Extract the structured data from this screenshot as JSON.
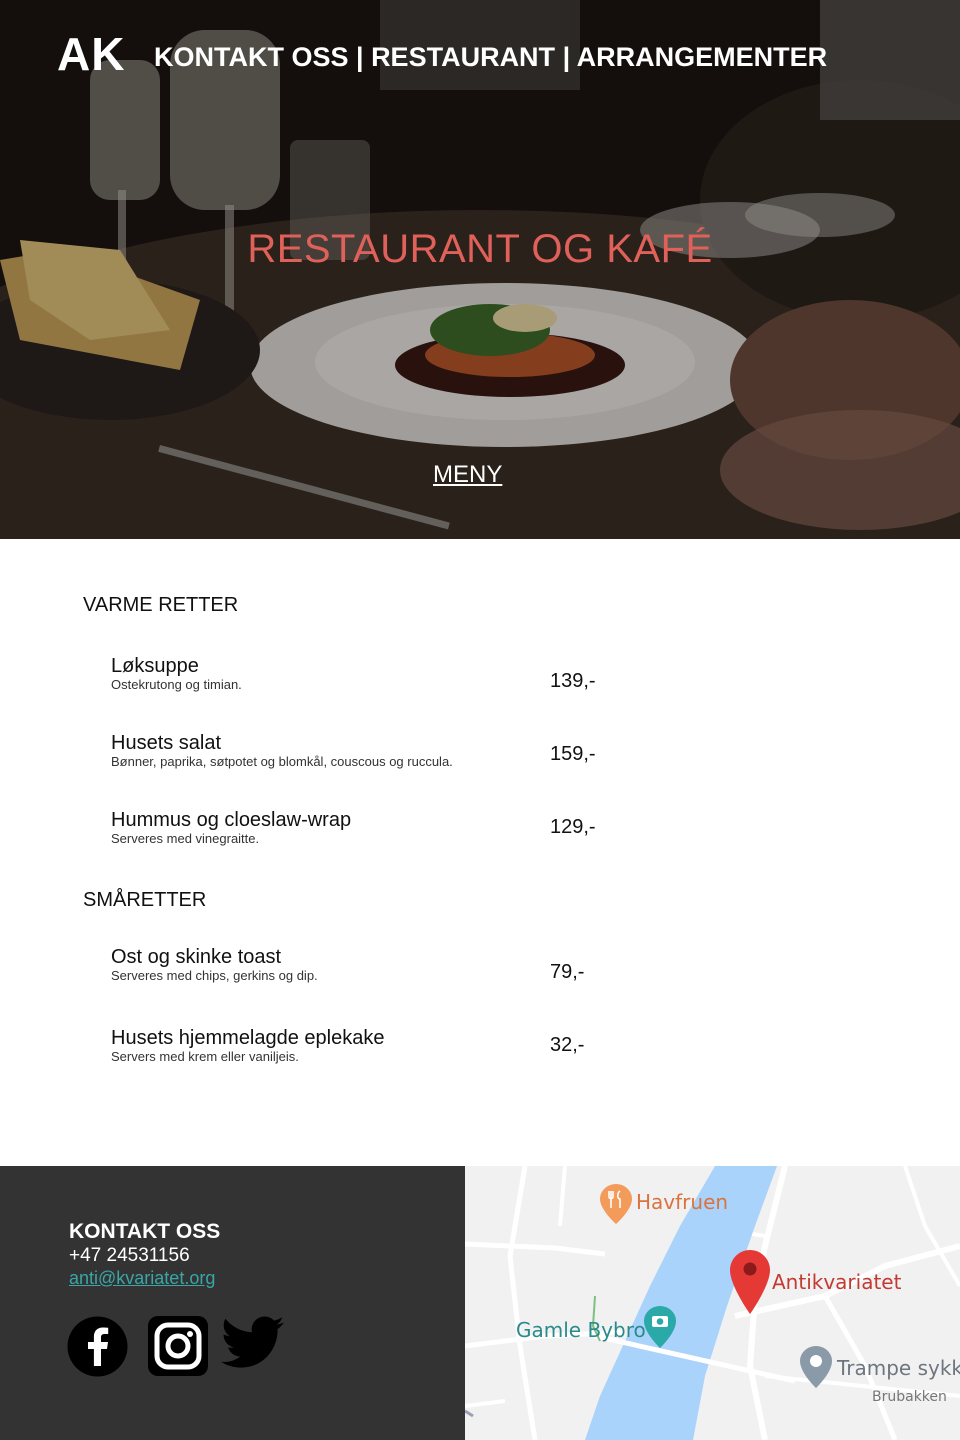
{
  "header": {
    "logo": "AK",
    "nav": [
      "KONTAKT OSS",
      "RESTAURANT",
      "ARRANGEMENTER"
    ],
    "separator": " | "
  },
  "hero": {
    "title": "RESTAURANT OG KAFÉ",
    "menu_link": "MENY"
  },
  "menu": {
    "sections": [
      {
        "title": "VARME RETTER",
        "items": [
          {
            "name": "Løksuppe",
            "description": "Ostekrutong og timian.",
            "price": "139,-"
          },
          {
            "name": "Husets salat",
            "description": "Bønner, paprika, søtpotet og blomkål, couscous og ruccula.",
            "price": "159,-"
          },
          {
            "name": "Hummus og cloeslaw-wrap",
            "description": "Serveres med vinegraitte.",
            "price": "129,-"
          }
        ]
      },
      {
        "title": "SMÅRETTER",
        "items": [
          {
            "name": "Ost og skinke toast",
            "description": "Serveres med chips, gerkins og dip.",
            "price": "79,-"
          },
          {
            "name": "Husets hjemmelagde eplekake",
            "description": "Servers med krem eller vaniljeis.",
            "price": "32,-"
          }
        ]
      }
    ]
  },
  "footer": {
    "contact_title": "KONTAKT OSS",
    "phone": "+47 24531156",
    "email": "anti@kvariatet.org",
    "social": [
      "facebook-icon",
      "instagram-icon",
      "twitter-icon"
    ]
  },
  "map": {
    "labels": {
      "havfruen": "Havfruen",
      "antikvariatet": "Antikvariatet",
      "gamle_bybro": "Gamle Bybro",
      "trampe": "Trampe sykk",
      "brubakken": "Brubakken"
    }
  },
  "colors": {
    "hero_title": "#e0605a",
    "footer_bg": "#333333",
    "link": "#3aa6a6",
    "river": "#a9d3fb",
    "map_pin": "#e53935",
    "map_label_orange": "#d9733f",
    "map_label_teal": "#2a8a8c"
  }
}
